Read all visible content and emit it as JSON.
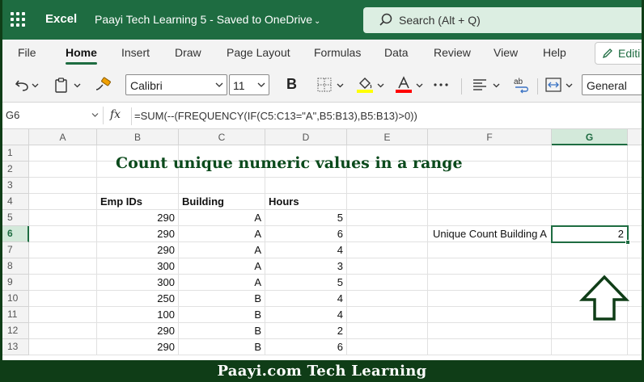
{
  "titlebar": {
    "app_name": "Excel",
    "doc_title": "Paayi Tech Learning 5",
    "save_status": " - Saved to OneDrive",
    "search_placeholder": "Search (Alt + Q)"
  },
  "tabs": [
    "File",
    "Home",
    "Insert",
    "Draw",
    "Page Layout",
    "Formulas",
    "Data",
    "Review",
    "View",
    "Help"
  ],
  "active_tab": "Home",
  "editing_label": "Editi",
  "toolbar": {
    "font_name": "Calibri",
    "font_size": "11",
    "bold_label": "B",
    "number_format": "General",
    "icons": [
      "undo-icon",
      "paste-icon",
      "format-painter-icon",
      "borders-icon",
      "fill-color-icon",
      "font-color-icon",
      "more-icon",
      "align-icon",
      "wrap-text-icon",
      "merge-icon"
    ],
    "fill_color": "#ffff00",
    "font_color": "#ff0000"
  },
  "formula_bar": {
    "name_box": "G6",
    "fx_label": "fx",
    "formula": "=SUM(--(FREQUENCY(IF(C5:C13=\"A\",B5:B13),B5:B13)>0))"
  },
  "columns": [
    "A",
    "B",
    "C",
    "D",
    "E",
    "F",
    "G"
  ],
  "selected_column": "G",
  "rows": [
    "1",
    "2",
    "3",
    "4",
    "5",
    "6",
    "7",
    "8",
    "9",
    "10",
    "11",
    "12",
    "13"
  ],
  "selected_row": "6",
  "sheet": {
    "title": "Count unique numeric values in a range",
    "headers": [
      "Emp IDs",
      "Building",
      "Hours"
    ],
    "data": [
      [
        "290",
        "A",
        "5"
      ],
      [
        "290",
        "A",
        "6"
      ],
      [
        "290",
        "A",
        "4"
      ],
      [
        "300",
        "A",
        "3"
      ],
      [
        "300",
        "A",
        "5"
      ],
      [
        "250",
        "B",
        "4"
      ],
      [
        "100",
        "B",
        "4"
      ],
      [
        "290",
        "B",
        "2"
      ],
      [
        "290",
        "B",
        "6"
      ]
    ],
    "result_label": "Unique Count Building A",
    "result_value": "2"
  },
  "banner": "Paayi.com Tech Learning",
  "colors": {
    "brand_green": "#1e6c41",
    "title_green": "#0b4a1c",
    "banner_bg": "#0f3d17"
  }
}
